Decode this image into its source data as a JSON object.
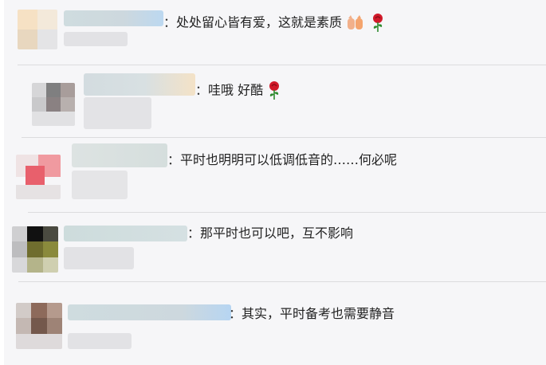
{
  "comments": [
    {
      "text": "处处留心皆有爱，这就是素质",
      "emoji": [
        "clap-hands-icon",
        "rose-icon"
      ]
    },
    {
      "text": "哇哦 好酷",
      "emoji": [
        "rose-icon"
      ]
    },
    {
      "text": "平时也明明可以低调低音的……何必呢",
      "emoji": []
    },
    {
      "text": "那平时也可以吧，互不影响",
      "emoji": []
    },
    {
      "text": "其实，平时备考也需要静音",
      "emoji": []
    }
  ],
  "separator": "：",
  "colors": {
    "background": "#f6f6f8",
    "separator_line": "#dcdcde",
    "rose": "#d11a2a",
    "stem": "#2e8b2e"
  }
}
